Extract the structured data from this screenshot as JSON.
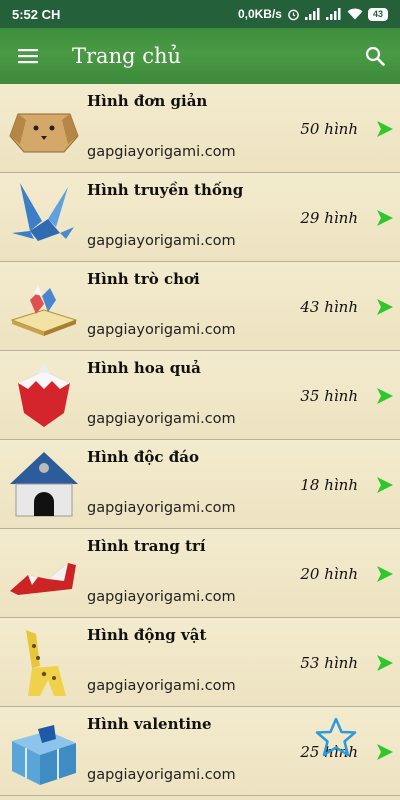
{
  "status_bar": {
    "time": "5:52 CH",
    "net_speed": "0,0KB/s",
    "battery": "43"
  },
  "app_bar": {
    "title": "Trang chủ",
    "menu_icon": "hamburger-menu-icon",
    "search_icon": "search-icon"
  },
  "categories": [
    {
      "title": "Hình đơn giản",
      "count": "50 hình",
      "site": "gapgiayorigami.com",
      "thumb": "origami-dog-face"
    },
    {
      "title": "Hình truyền thống",
      "count": "29 hình",
      "site": "gapgiayorigami.com",
      "thumb": "origami-bird"
    },
    {
      "title": "Hình trò chơi",
      "count": "43 hình",
      "site": "gapgiayorigami.com",
      "thumb": "origami-game-board"
    },
    {
      "title": "Hình hoa quả",
      "count": "35 hình",
      "site": "gapgiayorigami.com",
      "thumb": "origami-strawberry"
    },
    {
      "title": "Hình độc đáo",
      "count": "18 hình",
      "site": "gapgiayorigami.com",
      "thumb": "origami-house"
    },
    {
      "title": "Hình trang trí",
      "count": "20 hình",
      "site": "gapgiayorigami.com",
      "thumb": "origami-shoe"
    },
    {
      "title": "Hình động vật",
      "count": "53 hình",
      "site": "gapgiayorigami.com",
      "thumb": "origami-giraffe"
    },
    {
      "title": "Hình valentine",
      "count": "25 hình",
      "site": "gapgiayorigami.com",
      "thumb": "origami-gift-box"
    }
  ],
  "colors": {
    "status_bar": "#24603a",
    "app_bar": "#3e8d3c",
    "arrow": "#2ec82a",
    "background": "#ece3c4",
    "star": "#2a9be0"
  },
  "floating": {
    "icon": "star-outline-icon"
  }
}
